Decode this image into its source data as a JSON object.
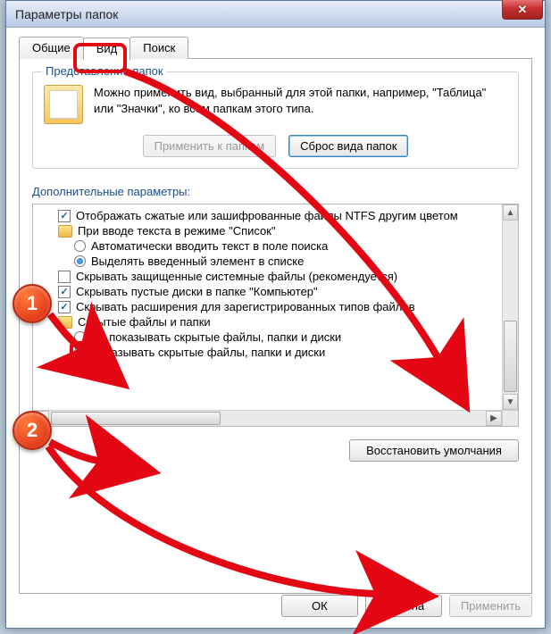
{
  "window": {
    "title": "Параметры папок"
  },
  "tabs": {
    "general": "Общие",
    "view": "Вид",
    "search": "Поиск"
  },
  "folderViews": {
    "groupTitle": "Представление папок",
    "description": "Можно применить вид, выбранный для этой папки, например, \"Таблица\" или \"Значки\", ко всем папкам этого типа.",
    "applyBtn": "Применить к папкам",
    "resetBtn": "Сброс вида папок"
  },
  "advanced": {
    "label": "Дополнительные параметры:",
    "items": {
      "showCompressed": "Отображать сжатые или зашифрованные файлы NTFS другим цветом",
      "typeAhead": "При вводе текста в режиме \"Список\"",
      "typeAheadAuto": "Автоматически вводить текст в поле поиска",
      "typeAheadSelect": "Выделять введенный элемент в списке",
      "hideProtected": "Скрывать защищенные системные файлы (рекомендуется)",
      "hideEmptyDrives": "Скрывать пустые диски в папке \"Компьютер\"",
      "hideExtensions": "Скрывать расширения для зарегистрированных типов файлов",
      "hiddenFiles": "Скрытые файлы и папки",
      "dontShowHidden": "Не показывать скрытые файлы, папки и диски",
      "showHidden": "Показывать скрытые файлы, папки и диски"
    }
  },
  "restoreBtn": "Восстановить умолчания",
  "dialog": {
    "ok": "ОК",
    "cancel": "Отмена",
    "apply": "Применить"
  },
  "annotations": {
    "step1": "1",
    "step2": "2"
  }
}
